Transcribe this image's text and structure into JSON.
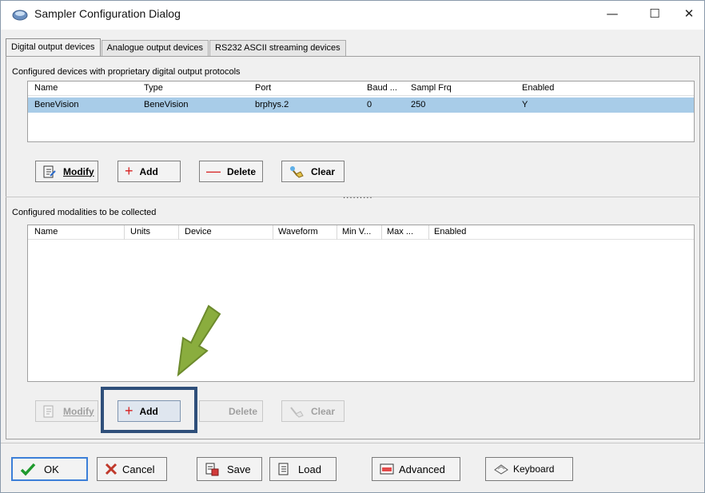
{
  "window": {
    "title": "Sampler Configuration Dialog",
    "minimize": "—",
    "maximize": "☐",
    "close": "✕"
  },
  "tabs": [
    "Digital output devices",
    "Analogue output devices",
    "RS232 ASCII streaming devices"
  ],
  "devices": {
    "label": "Configured devices with proprietary digital output protocols",
    "columns": [
      "Name",
      "Type",
      "Port",
      "Baud ...",
      "Sampl Frq",
      "Enabled"
    ],
    "rows": [
      {
        "name": "BeneVision",
        "type": "BeneVision",
        "port": "brphys.2",
        "baud": "0",
        "sampl_frq": "250",
        "enabled": "Y"
      }
    ],
    "buttons": {
      "modify": "Modify",
      "add": "Add",
      "delete": "Delete",
      "clear": "Clear"
    }
  },
  "splitter": {
    "dots": "........."
  },
  "modalities": {
    "label": "Configured modalities to be collected",
    "columns": [
      "Name",
      "Units",
      "Device",
      "Waveform",
      "Min V...",
      "Max ...",
      "Enabled"
    ],
    "rows": [],
    "buttons": {
      "modify": "Modify",
      "add": "Add",
      "delete": "Delete",
      "clear": "Clear"
    }
  },
  "footer": {
    "ok": "OK",
    "cancel": "Cancel",
    "save": "Save",
    "load": "Load",
    "advanced": "Advanced",
    "keyboard": "Keyboard"
  },
  "colors": {
    "selection": "#a8cce8",
    "highlight_border": "#2f4f7a",
    "arrow": "#8aad3e",
    "ok_check": "#1f9a2e",
    "cancel_x": "#c0392b",
    "add_plus": "#d62020"
  }
}
